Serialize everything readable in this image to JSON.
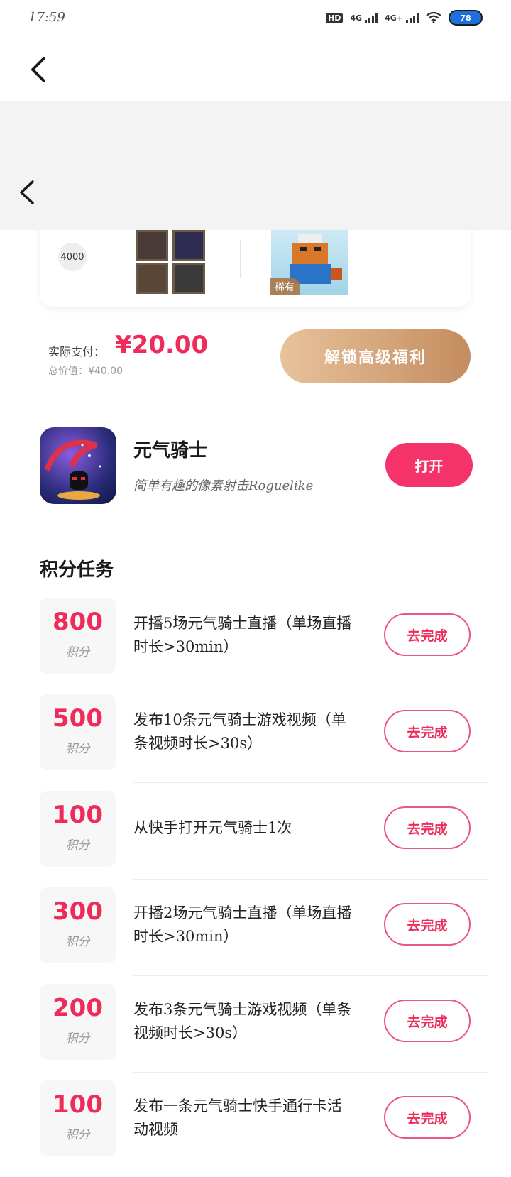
{
  "status_bar": {
    "time": "17:59",
    "hd": "HD",
    "net1": "4G",
    "net2": "4G+",
    "battery": "78"
  },
  "reward": {
    "points_chip": "4000",
    "rare_tag": "稀有"
  },
  "payment": {
    "label": "实际支付：",
    "price": "¥20.00",
    "original": "总价值：¥40.00",
    "unlock_button": "解锁高级福利"
  },
  "game": {
    "name": "元气骑士",
    "description": "简单有趣的像素射击Roguelike",
    "open_button": "打开"
  },
  "tasks_section": {
    "title": "积分任务",
    "items": [
      {
        "points": "800",
        "unit": "积分",
        "desc": "开播5场元气骑士直播（单场直播时长>30min）",
        "button": "去完成"
      },
      {
        "points": "500",
        "unit": "积分",
        "desc": "发布10条元气骑士游戏视频（单条视频时长>30s）",
        "button": "去完成"
      },
      {
        "points": "100",
        "unit": "积分",
        "desc": "从快手打开元气骑士1次",
        "button": "去完成"
      },
      {
        "points": "300",
        "unit": "积分",
        "desc": "开播2场元气骑士直播（单场直播时长>30min）",
        "button": "去完成"
      },
      {
        "points": "200",
        "unit": "积分",
        "desc": "发布3条元气骑士游戏视频（单条视频时长>30s）",
        "button": "去完成"
      },
      {
        "points": "100",
        "unit": "积分",
        "desc": "发布一条元气骑士快手通行卡活动视频",
        "button": "去完成"
      }
    ]
  },
  "colors": {
    "accent": "#ee2b5a",
    "open_button": "#f5336b",
    "unlock_gradient_start": "#e8c29b",
    "unlock_gradient_end": "#c48c5f"
  }
}
